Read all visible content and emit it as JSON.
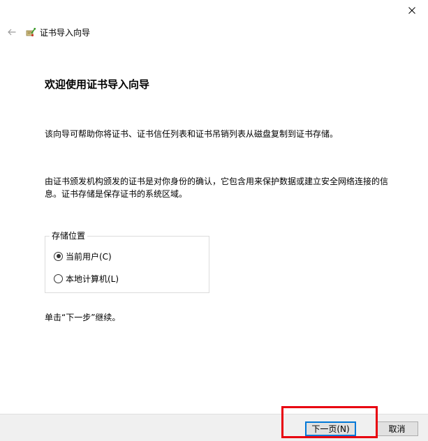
{
  "window": {
    "title": "证书导入向导",
    "close_icon": "close-icon",
    "back_icon": "back-arrow-icon",
    "app_icon": "certificate-wizard-icon"
  },
  "main": {
    "heading": "欢迎使用证书导入向导",
    "intro": "该向导可帮助你将证书、证书信任列表和证书吊销列表从磁盘复制到证书存储。",
    "description": "由证书颁发机构颁发的证书是对你身份的确认，它包含用来保护数据或建立安全网络连接的信息。证书存储是保存证书的系统区域。",
    "store_location": {
      "legend": "存储位置",
      "options": [
        {
          "label": "当前用户(C)",
          "selected": true
        },
        {
          "label": "本地计算机(L)",
          "selected": false
        }
      ]
    },
    "continue_hint": "单击“下一步”继续。"
  },
  "footer": {
    "next_label": "下一页(N)",
    "cancel_label": "取消"
  },
  "colors": {
    "accent": "#0078d7",
    "highlight": "#e8000f",
    "footer_bg": "#f0f0f0"
  }
}
